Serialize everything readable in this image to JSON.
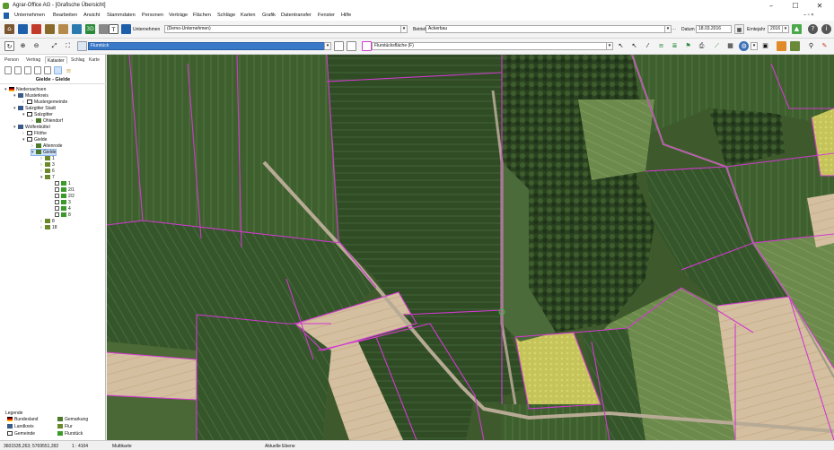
{
  "window": {
    "title": "Agrar-Office AG - [Grafische Übersicht]",
    "minimize": "–",
    "maximize": "☐",
    "close": "✕"
  },
  "menu": {
    "items": [
      "Unternehmen",
      "Bearbeiten",
      "Ansicht",
      "Stammdaten",
      "Personen",
      "Verträge",
      "Flächen",
      "Schläge",
      "Karten",
      "Grafik",
      "Datentransfer",
      "Fenster",
      "Hilfe"
    ],
    "right_controls": "– ▫ ×"
  },
  "toolbar1": {
    "unternehmen_label": "Unternehmen",
    "unternehmen_value": "(Demo-Unternehmen)",
    "betrieb_label": "Betrieb",
    "betrieb_value": "Ackerbau",
    "datum_label": "Datum",
    "datum_value": "18.03.2016",
    "erntejahr_label": "Erntejahr",
    "erntejahr_value": "2016"
  },
  "toolbar2": {
    "layer_value": "Flurstück",
    "filter_value": "Flurstücksfläche (F)"
  },
  "leftpanel": {
    "tabs": [
      "Person",
      "Vertrag",
      "Kataster",
      "Schlag",
      "Karte"
    ],
    "active_tab": "Kataster",
    "title": "Gielde - Gielde",
    "tree": [
      {
        "label": "Niedersachsen",
        "icon": "flag-icon"
      },
      {
        "label": "Musterkreis",
        "icon": "landkreis-icon"
      },
      {
        "label": "Mustergemeinde",
        "icon": "gemeinde-icon"
      },
      {
        "label": "Salzgitter Stadt",
        "icon": "landkreis-icon"
      },
      {
        "label": "Salzgitter",
        "icon": "gemeinde-icon"
      },
      {
        "label": "Ohlendorf",
        "icon": "gemarkung-icon"
      },
      {
        "label": "Wolfenbüttel",
        "icon": "landkreis-icon"
      },
      {
        "label": "Flöthe",
        "icon": "gemeinde-icon"
      },
      {
        "label": "Gielde",
        "icon": "gemeinde-icon"
      },
      {
        "label": "Altenrode",
        "icon": "gemarkung-icon"
      },
      {
        "label": "Gielde",
        "icon": "gemarkung-icon"
      },
      {
        "label": "1",
        "icon": "flur-icon"
      },
      {
        "label": "3",
        "icon": "flur-icon"
      },
      {
        "label": "6",
        "icon": "flur-icon"
      },
      {
        "label": "7",
        "icon": "flur-icon"
      },
      {
        "label": "1",
        "icon": "flurstueck-icon"
      },
      {
        "label": "2/1",
        "icon": "flurstueck-icon"
      },
      {
        "label": "2/2",
        "icon": "flurstueck-icon"
      },
      {
        "label": "3",
        "icon": "flurstueck-icon"
      },
      {
        "label": "4",
        "icon": "flurstueck-icon"
      },
      {
        "label": "8",
        "icon": "flurstueck-icon"
      },
      {
        "label": "8",
        "icon": "flur-icon"
      },
      {
        "label": "18",
        "icon": "flur-icon"
      }
    ],
    "legend_title": "Legende",
    "legend": [
      {
        "label": "Bundesland",
        "icon": "flag-icon"
      },
      {
        "label": "Gemarkung",
        "icon": "gemarkung-icon"
      },
      {
        "label": "Landkreis",
        "icon": "landkreis-icon"
      },
      {
        "label": "Flur",
        "icon": "flur-icon"
      },
      {
        "label": "Gemeinde",
        "icon": "gemeinde-icon"
      },
      {
        "label": "Flurstück",
        "icon": "flurstueck-icon"
      }
    ]
  },
  "statusbar": {
    "coords": "3601535,263; 5769551,392",
    "scale": "1 : 4104",
    "mode": "Multikarte",
    "layer": "Aktuelle Ebene"
  },
  "colors": {
    "accent": "#1d5fa8",
    "parcel_border": "#d23ad0",
    "selected": "#cfe3fb"
  }
}
